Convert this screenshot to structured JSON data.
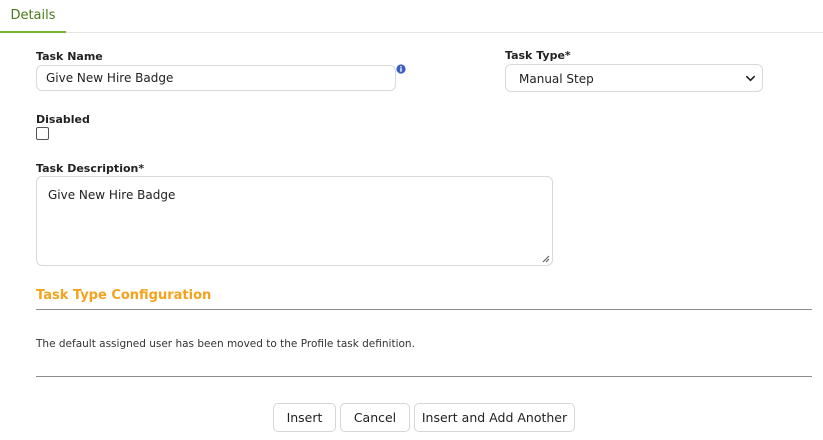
{
  "tabs": [
    {
      "label": "Details",
      "active": true
    }
  ],
  "form": {
    "task_name": {
      "label": "Task Name",
      "value": "Give New Hire Badge"
    },
    "task_type": {
      "label": "Task Type*",
      "value": "Manual Step"
    },
    "disabled": {
      "label": "Disabled",
      "checked": false
    },
    "task_description": {
      "label": "Task Description*",
      "value": "Give New Hire Badge"
    }
  },
  "section": {
    "title": "Task Type Configuration",
    "message": "The default assigned user has been moved to the Profile task definition."
  },
  "buttons": {
    "insert": "Insert",
    "cancel": "Cancel",
    "insert_add": "Insert and Add Another"
  },
  "colors": {
    "tab_accent": "#7ab32e",
    "section_title": "#f4a21c",
    "info_icon": "#3b5fc0"
  },
  "icons": {
    "info": "info-icon",
    "select": "chevron-down-icon",
    "resize": "resize-grip-icon"
  }
}
